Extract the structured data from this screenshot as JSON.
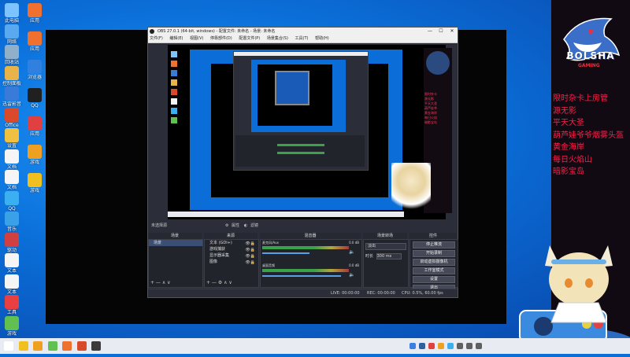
{
  "desktop": {
    "icons_left": [
      {
        "label": "此电脑",
        "color": "#7dc3ff"
      },
      {
        "label": "网络",
        "color": "#5aa8ef"
      },
      {
        "label": "回收站",
        "color": "#8fb0c8"
      },
      {
        "label": "控制面板",
        "color": "#e8b44a"
      },
      {
        "label": "迅雷影音",
        "color": "#3a7ad8"
      },
      {
        "label": "Office",
        "color": "#d84a2a"
      },
      {
        "label": "设置",
        "color": "#f0c040"
      },
      {
        "label": "文档",
        "color": "#f5f5f5"
      },
      {
        "label": "文档",
        "color": "#f5f5f5"
      },
      {
        "label": "QQ",
        "color": "#3ab0f0"
      },
      {
        "label": "音乐",
        "color": "#3aa0e8"
      },
      {
        "label": "驱动",
        "color": "#d04040"
      },
      {
        "label": "文本",
        "color": "#f5f5f5"
      },
      {
        "label": "文本",
        "color": "#f5f5f5"
      },
      {
        "label": "工具",
        "color": "#e84040"
      },
      {
        "label": "游戏",
        "color": "#60c050"
      }
    ],
    "icons_second": [
      {
        "label": "应用",
        "color": "#f07030"
      },
      {
        "label": "应用",
        "color": "#f07030"
      },
      {
        "label": "浏览器",
        "color": "#3080e0"
      },
      {
        "label": "QQ",
        "color": "#202020"
      },
      {
        "label": "应用",
        "color": "#e04040"
      },
      {
        "label": "游戏",
        "color": "#f0a020"
      },
      {
        "label": "游戏",
        "color": "#f0c020"
      }
    ]
  },
  "obs": {
    "title": "OBS 27.0.1 (64-bit, windows) - 配置文件: 未命名 - 场景: 未命名",
    "menu": [
      "文件(F)",
      "编辑(E)",
      "视图(V)",
      "停靠部件(D)",
      "配置文件(P)",
      "场景集合(S)",
      "工具(T)",
      "帮助(H)"
    ],
    "no_source": "未选择源",
    "prop_btn": "属性",
    "filter_btn": "滤镜",
    "docks": {
      "scenes_title": "场景",
      "scenes": [
        "场景"
      ],
      "sources_title": "来源",
      "sources": [
        "文本 (GDI+)",
        "游戏捕获",
        "显示器采集",
        "图像"
      ],
      "mixer_title": "混音器",
      "mixer": [
        {
          "name": "麦克风/Aux",
          "level": "0.0 dB"
        },
        {
          "name": "桌面音频",
          "level": "0.0 dB"
        }
      ],
      "transitions_title": "场景转场",
      "transition_value": "淡出",
      "duration_label": "时长",
      "duration_value": "300 ms",
      "controls_title": "控件",
      "controls": [
        "停止推流",
        "开始录制",
        "启动虚拟摄像机",
        "工作室模式",
        "设置",
        "退出"
      ]
    },
    "status": {
      "live": "LIVE: 00:00:00",
      "rec": "REC: 00:00:00",
      "cpu": "CPU: 0.5%, 60.00 fps"
    }
  },
  "promo_lines": [
    "限时杂卡上房管",
    "源无影",
    "平天大圣",
    "葫芦娃爷爷烟雾头盔",
    "黄金海岸",
    "每日火焰山",
    "暗影宝岛"
  ],
  "logo": {
    "line1": "BOLSHA",
    "line2": "GAMING"
  },
  "taskbar": {
    "icons": [
      "#ffffff",
      "#f0c020",
      "#f0a020",
      "#60c050",
      "#f07030",
      "#d84a2a",
      "#3a3a3a"
    ],
    "tray": [
      "#3a80e0",
      "#3060a0",
      "#e04040",
      "#f0a020",
      "#3ab0f0",
      "#606060",
      "#606060",
      "#606060"
    ]
  }
}
